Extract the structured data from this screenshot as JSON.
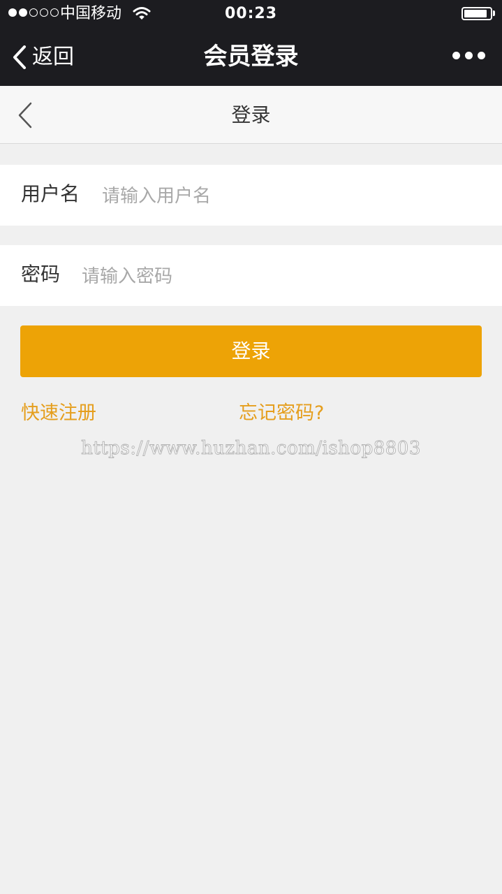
{
  "status_bar": {
    "signal_filled": 2,
    "signal_total": 5,
    "carrier": "中国移动",
    "wifi_icon": "wifi-icon",
    "time": "00:23",
    "battery_level": 0.9
  },
  "nav_bar": {
    "back_label": "返回",
    "title": "会员登录",
    "more_icon": "more-dots-icon"
  },
  "page_header": {
    "back_icon": "chevron-left-icon",
    "title": "登录"
  },
  "form": {
    "username_label": "用户名",
    "username_placeholder": "请输入用户名",
    "username_value": "",
    "password_label": "密码",
    "password_placeholder": "请输入密码",
    "password_value": "",
    "submit_label": "登录"
  },
  "links": {
    "register": "快速注册",
    "forgot_password": "忘记密码?"
  },
  "watermark": "https://www.huzhan.com/ishop8803",
  "colors": {
    "nav_background": "#1c1c20",
    "accent": "#eda306",
    "link": "#e59e1d",
    "page_background": "#f0f0f0"
  }
}
